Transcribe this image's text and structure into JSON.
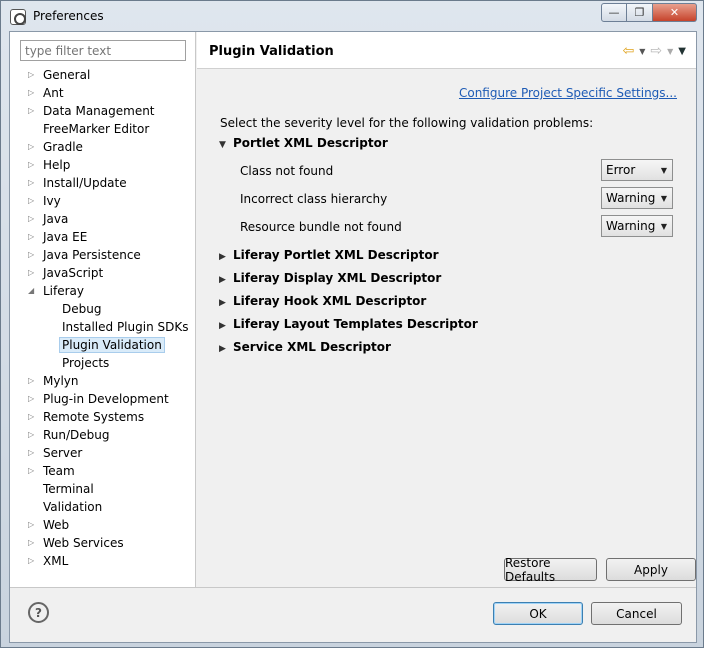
{
  "window": {
    "title": "Preferences",
    "minimize": "—",
    "maximize": "❐",
    "close": "✕"
  },
  "filter": {
    "placeholder": "type filter text"
  },
  "tree": [
    {
      "label": "General",
      "expandable": true
    },
    {
      "label": "Ant",
      "expandable": true
    },
    {
      "label": "Data Management",
      "expandable": true
    },
    {
      "label": "FreeMarker Editor",
      "expandable": false
    },
    {
      "label": "Gradle",
      "expandable": true
    },
    {
      "label": "Help",
      "expandable": true
    },
    {
      "label": "Install/Update",
      "expandable": true
    },
    {
      "label": "Ivy",
      "expandable": true
    },
    {
      "label": "Java",
      "expandable": true
    },
    {
      "label": "Java EE",
      "expandable": true
    },
    {
      "label": "Java Persistence",
      "expandable": true
    },
    {
      "label": "JavaScript",
      "expandable": true
    },
    {
      "label": "Liferay",
      "expandable": true,
      "expanded": true
    },
    {
      "label": "Debug",
      "child": true
    },
    {
      "label": "Installed Plugin SDKs",
      "child": true
    },
    {
      "label": "Plugin Validation",
      "child": true,
      "selected": true
    },
    {
      "label": "Projects",
      "child": true
    },
    {
      "label": "Mylyn",
      "expandable": true
    },
    {
      "label": "Plug-in Development",
      "expandable": true
    },
    {
      "label": "Remote Systems",
      "expandable": true
    },
    {
      "label": "Run/Debug",
      "expandable": true
    },
    {
      "label": "Server",
      "expandable": true
    },
    {
      "label": "Team",
      "expandable": true
    },
    {
      "label": "Terminal",
      "expandable": false
    },
    {
      "label": "Validation",
      "expandable": false
    },
    {
      "label": "Web",
      "expandable": true
    },
    {
      "label": "Web Services",
      "expandable": true
    },
    {
      "label": "XML",
      "expandable": true
    }
  ],
  "page": {
    "title": "Plugin Validation",
    "config_link": "Configure Project Specific Settings...",
    "instruction": "Select the severity level for the following validation problems:",
    "expanded_section": "Portlet XML Descriptor",
    "rows": [
      {
        "label": "Class not found",
        "value": "Error"
      },
      {
        "label": "Incorrect class hierarchy",
        "value": "Warning"
      },
      {
        "label": "Resource bundle not found",
        "value": "Warning"
      }
    ],
    "collapsed_sections": [
      "Liferay Portlet XML Descriptor",
      "Liferay Display XML Descriptor",
      "Liferay Hook XML Descriptor",
      "Liferay Layout Templates Descriptor",
      "Service XML Descriptor"
    ],
    "restore_defaults": "Restore Defaults",
    "apply": "Apply"
  },
  "footer": {
    "help": "?",
    "ok": "OK",
    "cancel": "Cancel"
  },
  "icons": {
    "back": "⇦",
    "forward": "⇨",
    "dropdown": "▼",
    "menu": "▼",
    "expand": "▷",
    "collapse": "◢",
    "section_expanded": "▼",
    "section_collapsed": "▶"
  }
}
